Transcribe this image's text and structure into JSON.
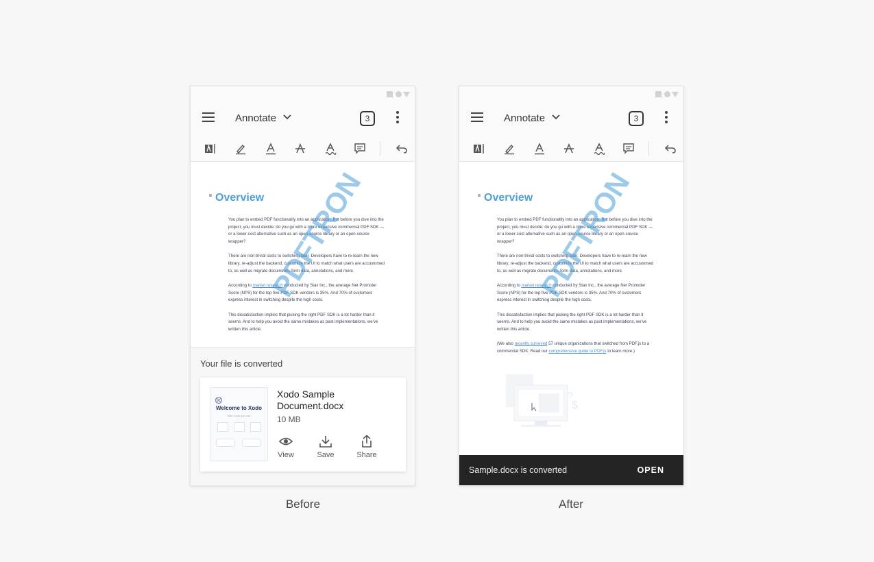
{
  "captions": {
    "before": "Before",
    "after": "After"
  },
  "app_bar": {
    "mode_label": "Annotate",
    "tabs_count": "3"
  },
  "toolbar": {
    "tools": [
      "text-box-icon",
      "freehand-pen-icon",
      "text-underline-icon",
      "text-strikeout-icon",
      "text-squiggly-icon",
      "comment-icon",
      "undo-icon"
    ]
  },
  "document": {
    "title": "Overview",
    "paragraphs": [
      {
        "text": "You plan to embed PDF functionality into an application. But before you dive into the project, you must decide: do you go with a more expensive commercial PDF SDK — or a lower-cost alternative such as an open-source library or an open-source wrapper?"
      },
      {
        "text": "There are non-trivial costs to switching later. Developers have to re-learn the new library, re-adjust the backend, customize the UI to match what users are accustomed to, as well as migrate documents, form data, annotations, and more."
      },
      {
        "pre": "According to ",
        "link": "market research",
        "post": " conducted by Stax Inc., the average Net Promoter Score (NPS) for the top five PDF SDK vendors is 35%. And 70% of customers express interest in switching despite the high costs."
      },
      {
        "text": "This dissatisfaction implies that picking the right PDF SDK is a lot harder than it seems. And to help you avoid the same mistakes as past implementations, we've written this article."
      },
      {
        "pre": "(We also ",
        "link": "recently surveyed",
        "mid": " 57 unique organizations that switched from PDF.js to a commercial SDK. Read our ",
        "link2": "comprehensive guide to PDF.js",
        "post": " to learn more.)"
      }
    ],
    "watermark": "PDFTRON"
  },
  "sheet": {
    "heading": "Your file is converted",
    "file": {
      "name": "Xodo Sample Document.docx",
      "size": "10 MB",
      "thumbnail_title": "Welcome to Xodo",
      "thumbnail_subtitle": "With Xodo you can"
    },
    "actions": {
      "view": "View",
      "save": "Save",
      "share": "Share"
    }
  },
  "snackbar": {
    "message": "Sample.docx is converted",
    "action": "OPEN"
  },
  "colors": {
    "accent": "#4e9fd8",
    "snackbar_bg": "#242424",
    "link": "#4e8fd0"
  }
}
